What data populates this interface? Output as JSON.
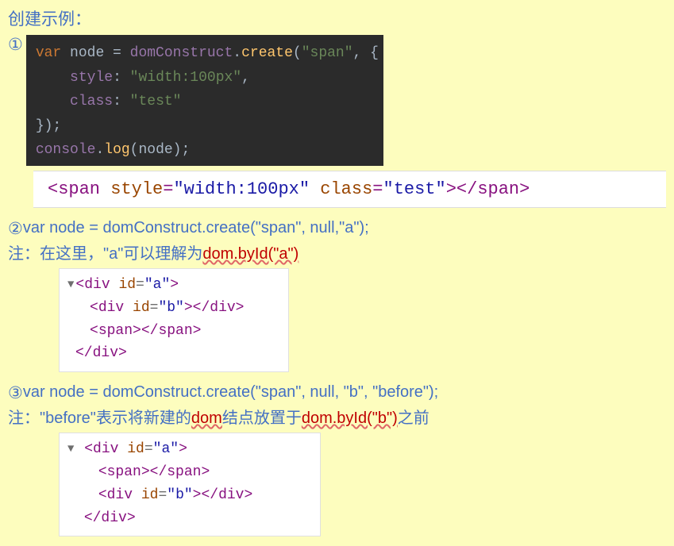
{
  "heading": "创建示例：",
  "marker1": "①",
  "darkcode": {
    "line1_kw": "var",
    "line1_ident": " node ",
    "line1_eq": "= ",
    "line1_obj": "domConstruct",
    "line1_dot": ".",
    "line1_fn": "create",
    "line1_paren": "(",
    "line1_str": "\"span\"",
    "line1_rest": ", {",
    "line2_pad": "    ",
    "line2_key": "style",
    "line2_col": ": ",
    "line2_val": "\"width:100px\"",
    "line2_end": ",",
    "line3_pad": "    ",
    "line3_key": "class",
    "line3_col": ": ",
    "line3_val": "\"test\"",
    "line4": "});",
    "line5_obj": "console",
    "line5_dot": ".",
    "line5_fn": "log",
    "line5_rest": "(node);"
  },
  "htmlwide": {
    "open": "<span ",
    "attr1": "style",
    "eq": "=",
    "val1": "\"width:100px\"",
    "sp": " ",
    "attr2": "class",
    "val2": "\"test\"",
    "close1": ">",
    "close2": "</span>"
  },
  "marker2": "②",
  "ex2_code": "var node = domConstruct.create(\"span\", null,\"a\");",
  "ex2_note_pre": "注：在这里，\"a\"可以理解为",
  "ex2_note_link": "dom.byId(\"a\")",
  "dev1": {
    "l1_tag": "div",
    "l1_attr": "id",
    "l1_val": "\"a\"",
    "l2_tag": "div",
    "l2_attr": "id",
    "l2_val": "\"b\"",
    "l3_tag": "span",
    "l4_close": "div"
  },
  "marker3": "③",
  "ex3_code": "var node = domConstruct.create(\"span\", null, \"b\", \"before\");",
  "ex3_note_a": "注：\"before\"表示将新建的",
  "ex3_note_link1": "dom",
  "ex3_note_b": "结点放置于",
  "ex3_note_link2": "dom.byId(\"b\")",
  "ex3_note_c": "之前",
  "dev2": {
    "l1_tag": "div",
    "l1_attr": "id",
    "l1_val": "\"a\"",
    "l2_tag": "span",
    "l3_tag": "div",
    "l3_attr": "id",
    "l3_val": "\"b\"",
    "l4_close": "div"
  }
}
